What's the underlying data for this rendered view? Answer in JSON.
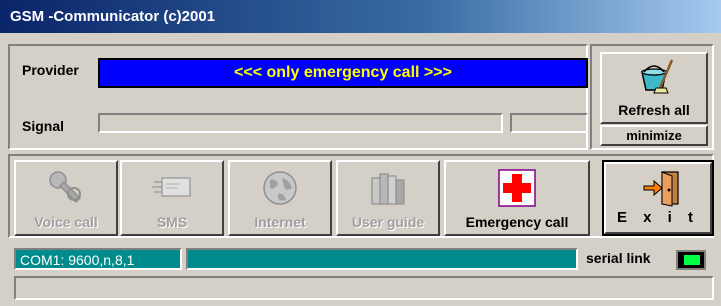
{
  "window": {
    "title": "GSM -Communicator (c)2001"
  },
  "provider": {
    "label": "Provider",
    "value": "<<< only emergency call >>>"
  },
  "signal": {
    "label": "Signal"
  },
  "refresh": {
    "label": "Refresh all"
  },
  "minimize": {
    "label": "minimize"
  },
  "toolbar": {
    "voice_call": "Voice call",
    "sms": "SMS",
    "internet": "Internet",
    "user_guide": "User guide",
    "emergency_call": "Emergency call",
    "exit": "E x i t"
  },
  "status": {
    "com_port": "COM1: 9600,n,8,1",
    "serial_link_label": "serial link",
    "serial_link_led": "on"
  },
  "colors": {
    "provider_bg": "#0000ff",
    "provider_text": "#ffff00",
    "status_bar": "#008c8c",
    "led_on": "#00ff40",
    "emergency_cross": "#ff0000"
  }
}
